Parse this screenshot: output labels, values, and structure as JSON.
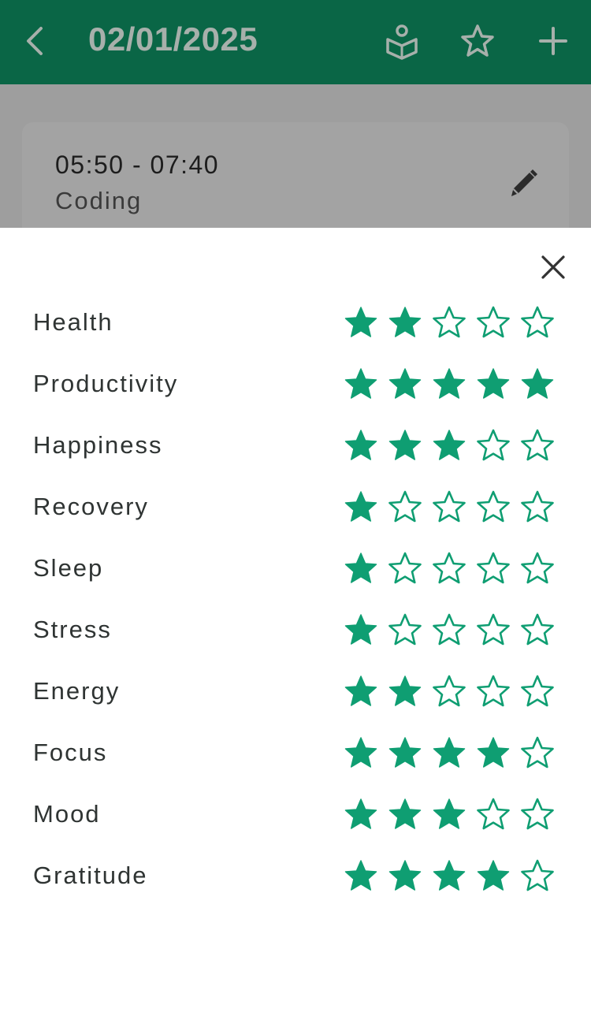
{
  "appbar": {
    "title": "02/01/2025",
    "icons": [
      "back-arrow-icon",
      "reading-book-icon",
      "star-outline-icon",
      "plus-icon"
    ]
  },
  "entry": {
    "time": "05:50 - 07:40",
    "label": "Coding",
    "icon": "pencil-edit-icon"
  },
  "sheet": {
    "close_icon": "close-icon",
    "star_color": "#0f9e72",
    "max_rating": 5,
    "ratings": [
      {
        "label": "Health",
        "value": 2
      },
      {
        "label": "Productivity",
        "value": 5
      },
      {
        "label": "Happiness",
        "value": 3
      },
      {
        "label": "Recovery",
        "value": 1
      },
      {
        "label": "Sleep",
        "value": 1
      },
      {
        "label": "Stress",
        "value": 1
      },
      {
        "label": "Energy",
        "value": 2
      },
      {
        "label": "Focus",
        "value": 4
      },
      {
        "label": "Mood",
        "value": 3
      },
      {
        "label": "Gratitude",
        "value": 4
      }
    ]
  }
}
